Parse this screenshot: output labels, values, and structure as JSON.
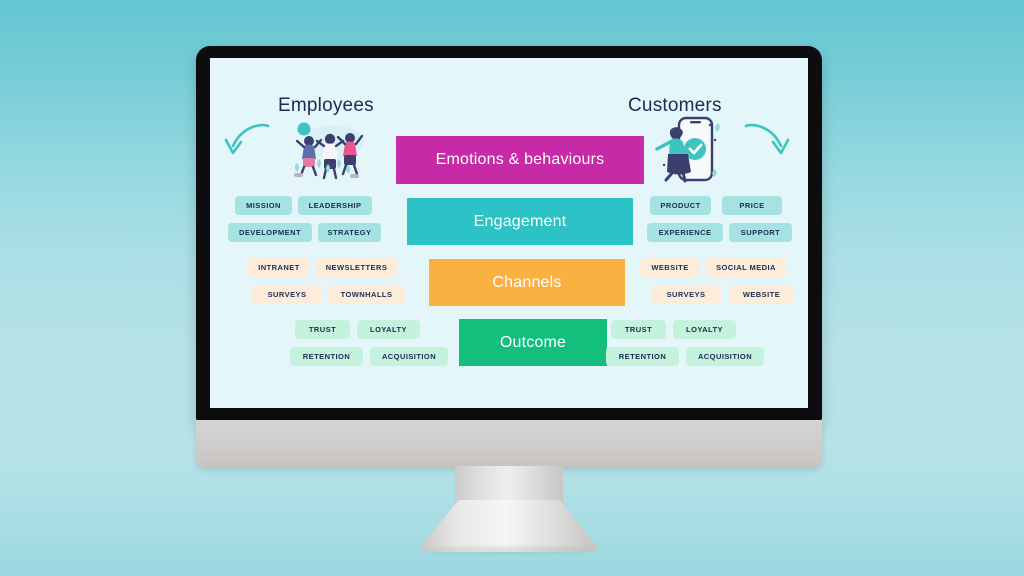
{
  "scene": {
    "background_top": "#62c6d2",
    "background_bottom": "#9ad7df",
    "device": "desktop-monitor"
  },
  "slide": {
    "background": "#e4f6fa",
    "columns": {
      "left_title": "Employees",
      "right_title": "Customers"
    },
    "center_bars": [
      {
        "label": "Emotions & behaviours",
        "color": "#c62aa6"
      },
      {
        "label": "Engagement",
        "color": "#2dc3c6"
      },
      {
        "label": "Channels",
        "color": "#fbb142"
      },
      {
        "label": "Outcome",
        "color": "#14bf7e"
      }
    ],
    "left_groups": [
      {
        "name": "employee-drivers",
        "color": "#a5e2e2",
        "tags": [
          "MISSION",
          "LEADERSHIP",
          "DEVELOPMENT",
          "STRATEGY"
        ]
      },
      {
        "name": "employee-channels",
        "color": "#fdecd9",
        "tags": [
          "INTRANET",
          "NEWSLETTERS",
          "SURVEYS",
          "TOWNHALLS"
        ]
      },
      {
        "name": "employee-outcomes",
        "color": "#c4f2dc",
        "tags": [
          "TRUST",
          "LOYALTY",
          "RETENTION",
          "ACQUISITION"
        ]
      }
    ],
    "right_groups": [
      {
        "name": "customer-drivers",
        "color": "#a5e2e2",
        "tags": [
          "PRODUCT",
          "PRICE",
          "EXPERIENCE",
          "SUPPORT"
        ]
      },
      {
        "name": "customer-channels",
        "color": "#fdecd9",
        "tags": [
          "WEBSITE",
          "SOCIAL MEDIA",
          "SURVEYS",
          "WEBSITE"
        ]
      },
      {
        "name": "customer-outcomes",
        "color": "#c4f2dc",
        "tags": [
          "TRUST",
          "LOYALTY",
          "RETENTION",
          "ACQUISITION"
        ]
      }
    ],
    "icons": {
      "left_arrow": "curved-arrow-down-left",
      "right_arrow": "curved-arrow-down-right",
      "left_illustration": "celebrating-employees-illustration",
      "right_illustration": "customer-mobile-checkmark-illustration"
    }
  }
}
